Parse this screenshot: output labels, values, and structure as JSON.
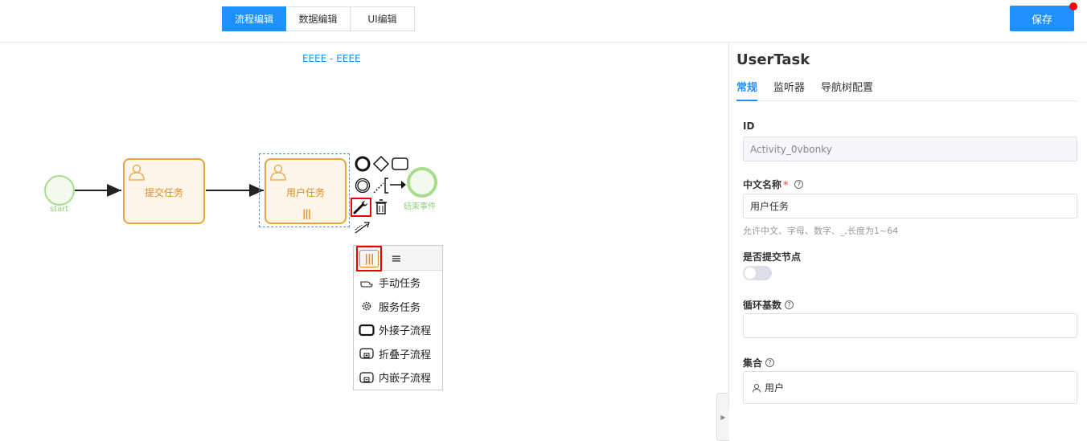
{
  "toolbar": {
    "tabs": [
      "流程编辑",
      "数据编辑",
      "UI编辑"
    ],
    "active_tab": 0,
    "save_label": "保存",
    "accent_color": "#1e90ff",
    "badge_color": "#ff0000"
  },
  "canvas": {
    "title": "EEEE - EEEE",
    "start_label": "start",
    "task1_label": "提交任务",
    "task2_label": "用户任务",
    "end_label": "结束事件",
    "task_color": "#e8a33d",
    "event_color": "#a8dc8c"
  },
  "popup": {
    "items": [
      {
        "label": "手动任务",
        "icon": "hand-icon"
      },
      {
        "label": "服务任务",
        "icon": "gear-icon"
      },
      {
        "label": "外接子流程",
        "icon": "rect-icon"
      },
      {
        "label": "折叠子流程",
        "icon": "collapsed-subprocess-icon"
      },
      {
        "label": "内嵌子流程",
        "icon": "embedded-subprocess-icon"
      }
    ]
  },
  "panel": {
    "title": "UserTask",
    "tabs": [
      "常规",
      "监听器",
      "导航树配置"
    ],
    "active_tab": 0,
    "id_label": "ID",
    "id_value": "Activity_0vbonky",
    "name_label": "中文名称",
    "name_required": "*",
    "name_value": "用户任务",
    "name_hint": "允许中文、字母、数字、_,长度为1~64",
    "submit_label": "是否提交节点",
    "submit_value": false,
    "loop_label": "循环基数",
    "loop_value": "",
    "collection_label": "集合",
    "collection_value": "用户"
  }
}
